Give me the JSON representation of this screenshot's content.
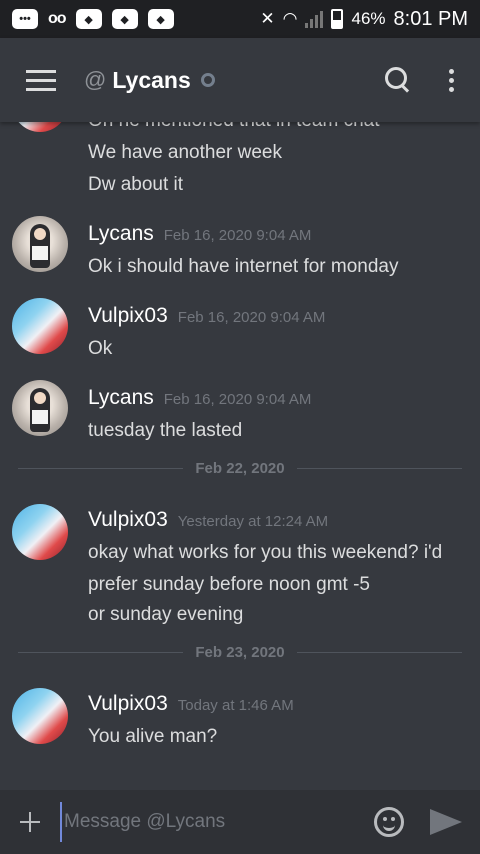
{
  "status_bar": {
    "battery": "46%",
    "time": "8:01 PM"
  },
  "header": {
    "at_symbol": "@",
    "title": "Lycans"
  },
  "messages": {
    "cont_partial": "Oh he mentioned that in team chat",
    "cont_1": "We have another week",
    "cont_2": "Dw about it",
    "groups": [
      {
        "author": "Lycans",
        "time": "Feb 16, 2020 9:04 AM",
        "lines": [
          "Ok i should have internet for monday"
        ]
      },
      {
        "author": "Vulpix03",
        "time": "Feb 16, 2020 9:04 AM",
        "lines": [
          "Ok"
        ]
      },
      {
        "author": "Lycans",
        "time": "Feb 16, 2020 9:04 AM",
        "lines": [
          "tuesday the lasted"
        ]
      },
      {
        "author": "Vulpix03",
        "time": "Yesterday at 12:24 AM",
        "lines": [
          "okay what works for you this weekend? i'd",
          "prefer sunday before noon gmt -5",
          "or sunday evening"
        ]
      },
      {
        "author": "Vulpix03",
        "time": "Today at 1:46 AM",
        "lines": [
          "You alive man?"
        ]
      }
    ],
    "dividers": [
      "Feb 22, 2020",
      "Feb 23, 2020"
    ]
  },
  "composer": {
    "placeholder": "Message @Lycans"
  },
  "colors": {
    "background": "#36393f",
    "statusbar": "#1f2023",
    "composer": "#2f3136",
    "accent": "#7289da",
    "muted": "#72767d"
  },
  "icons": [
    "hamburger-icon",
    "search-icon",
    "more-options-icon",
    "add-icon",
    "emoji-icon",
    "send-icon",
    "offline-status-icon"
  ]
}
